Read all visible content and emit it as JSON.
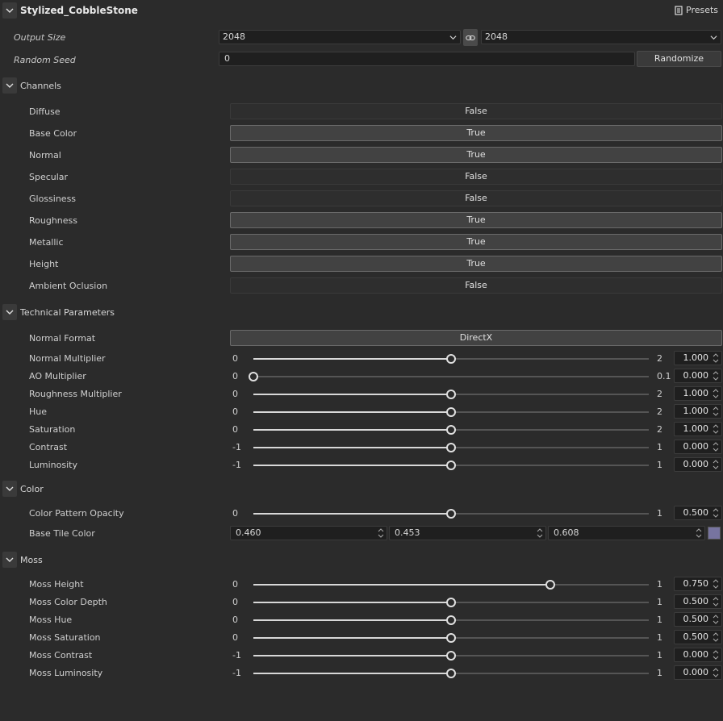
{
  "header": {
    "title": "Stylized_CobbleStone",
    "presets_label": "Presets"
  },
  "output_size": {
    "label": "Output Size",
    "width_value": "2048",
    "height_value": "2048"
  },
  "random_seed": {
    "label": "Random Seed",
    "value": "0",
    "randomize_label": "Randomize"
  },
  "channels": {
    "title": "Channels",
    "items": [
      {
        "label": "Diffuse",
        "value": "False"
      },
      {
        "label": "Base Color",
        "value": "True"
      },
      {
        "label": "Normal",
        "value": "True"
      },
      {
        "label": "Specular",
        "value": "False"
      },
      {
        "label": "Glossiness",
        "value": "False"
      },
      {
        "label": "Roughness",
        "value": "True"
      },
      {
        "label": "Metallic",
        "value": "True"
      },
      {
        "label": "Height",
        "value": "True"
      },
      {
        "label": "Ambient Oclusion",
        "value": "False"
      }
    ]
  },
  "technical": {
    "title": "Technical Parameters",
    "normal_format": {
      "label": "Normal Format",
      "value": "DirectX"
    },
    "sliders": [
      {
        "label": "Normal Multiplier",
        "min": "0",
        "max": "2",
        "value": "1.000",
        "fraction": 0.5
      },
      {
        "label": "AO Multiplier",
        "min": "0",
        "max": "0.1",
        "value": "0.000",
        "fraction": 0.0
      },
      {
        "label": "Roughness Multiplier",
        "min": "0",
        "max": "2",
        "value": "1.000",
        "fraction": 0.5
      },
      {
        "label": "Hue",
        "min": "0",
        "max": "2",
        "value": "1.000",
        "fraction": 0.5
      },
      {
        "label": "Saturation",
        "min": "0",
        "max": "2",
        "value": "1.000",
        "fraction": 0.5
      },
      {
        "label": "Contrast",
        "min": "-1",
        "max": "1",
        "value": "0.000",
        "fraction": 0.5
      },
      {
        "label": "Luminosity",
        "min": "-1",
        "max": "1",
        "value": "0.000",
        "fraction": 0.5
      }
    ]
  },
  "color": {
    "title": "Color",
    "opacity": {
      "label": "Color Pattern Opacity",
      "min": "0",
      "max": "1",
      "value": "0.500",
      "fraction": 0.5
    },
    "base_tile": {
      "label": "Base Tile Color",
      "r": "0.460",
      "g": "0.453",
      "b": "0.608",
      "swatch": "#7774a0"
    }
  },
  "moss": {
    "title": "Moss",
    "sliders": [
      {
        "label": "Moss Height",
        "min": "0",
        "max": "1",
        "value": "0.750",
        "fraction": 0.75
      },
      {
        "label": "Moss Color Depth",
        "min": "0",
        "max": "1",
        "value": "0.500",
        "fraction": 0.5
      },
      {
        "label": "Moss Hue",
        "min": "0",
        "max": "1",
        "value": "0.500",
        "fraction": 0.5
      },
      {
        "label": "Moss Saturation",
        "min": "0",
        "max": "1",
        "value": "0.500",
        "fraction": 0.5
      },
      {
        "label": "Moss Contrast",
        "min": "-1",
        "max": "1",
        "value": "0.000",
        "fraction": 0.5
      },
      {
        "label": "Moss Luminosity",
        "min": "-1",
        "max": "1",
        "value": "0.000",
        "fraction": 0.5
      }
    ]
  }
}
